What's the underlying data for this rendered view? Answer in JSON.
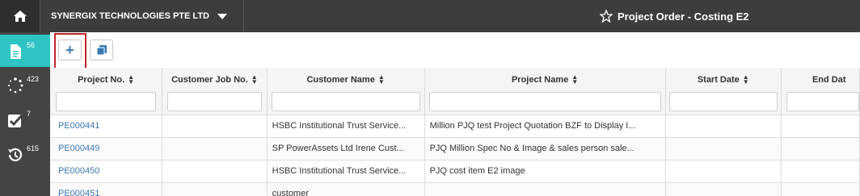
{
  "header": {
    "company": "SYNERGIX TECHNOLOGIES PTE LTD",
    "title": "Project Order - Costing E2"
  },
  "sidebar": {
    "items": [
      {
        "icon": "document-icon",
        "count": "56"
      },
      {
        "icon": "spinner-icon",
        "count": "423"
      },
      {
        "icon": "checkbox-icon",
        "count": "7"
      },
      {
        "icon": "history-icon",
        "count": "615"
      }
    ]
  },
  "toolbar": {
    "add_label": "+",
    "copy_icon": "copy-icon"
  },
  "grid": {
    "columns": [
      "Project No.",
      "Customer Job No.",
      "Customer Name",
      "Project Name",
      "Start Date",
      "End Dat"
    ],
    "rows": [
      [
        "PE000441",
        "",
        "HSBC Institutional Trust Service...",
        "Million PJQ test Project Quotation BZF to Display I...",
        "",
        ""
      ],
      [
        "PE000449",
        "",
        "SP PowerAssets Ltd Irene Cust...",
        "PJQ Million Spec No & Image & sales person sale...",
        "",
        ""
      ],
      [
        "PE000450",
        "",
        "HSBC Institutional Trust Service...",
        "PJQ cost item E2 image",
        "",
        ""
      ],
      [
        "PE000451",
        "",
        "customer",
        "",
        "",
        ""
      ]
    ]
  },
  "colors": {
    "topbar": "#3d3d3d",
    "sidebar": "#444444",
    "accent": "#2ec4c4",
    "highlight": "#c0232c",
    "link": "#3b78b3"
  }
}
